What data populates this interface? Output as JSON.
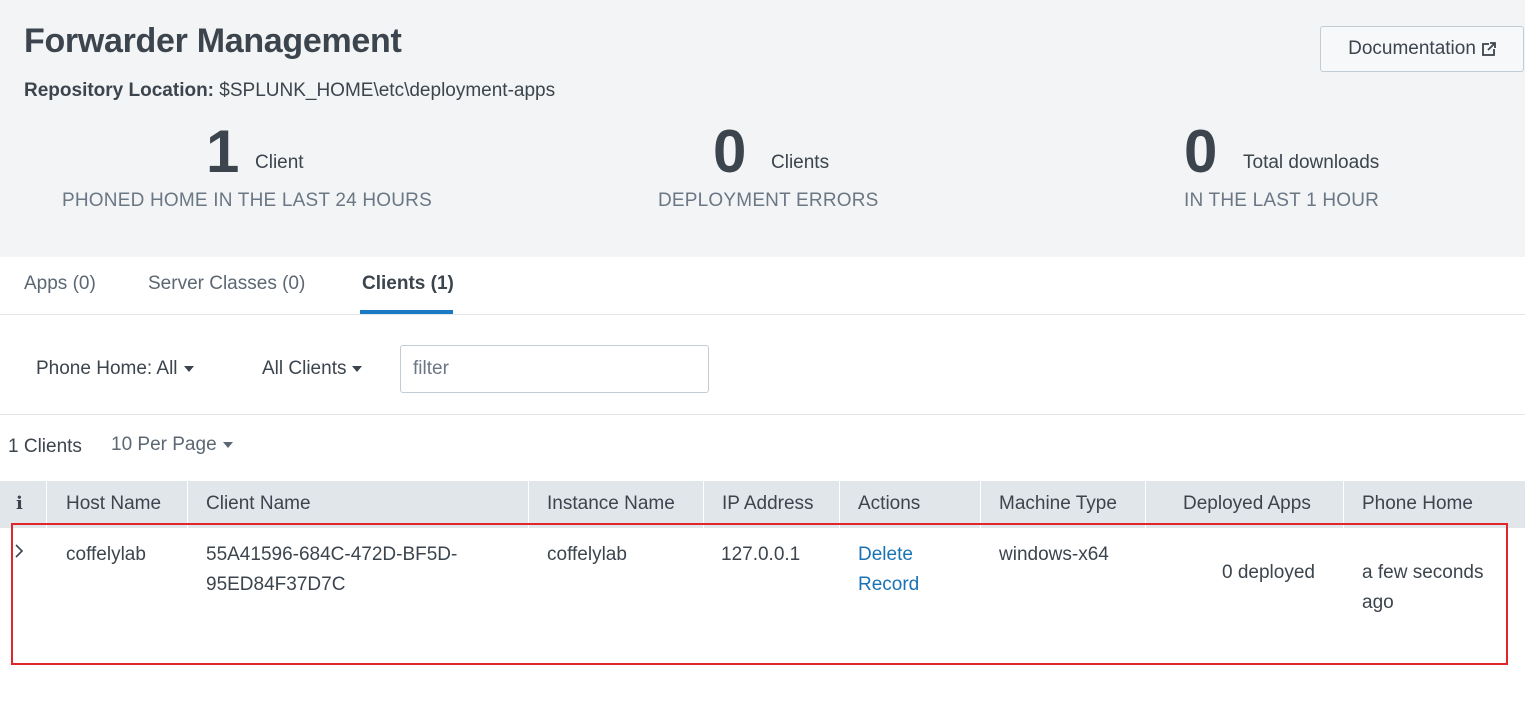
{
  "header": {
    "title": "Forwarder Management",
    "repo_label": "Repository Location:",
    "repo_path": "$SPLUNK_HOME\\etc\\deployment-apps",
    "doc_button": "Documentation",
    "doc_icon": "external-link-icon"
  },
  "stats": [
    {
      "value": "1",
      "unit": "Client",
      "caption": "PHONED HOME IN THE LAST 24 HOURS"
    },
    {
      "value": "0",
      "unit": "Clients",
      "caption": "DEPLOYMENT ERRORS"
    },
    {
      "value": "0",
      "unit": "Total downloads",
      "caption": "IN THE LAST 1 HOUR"
    }
  ],
  "tabs": [
    {
      "label": "Apps (0)",
      "active": false
    },
    {
      "label": "Server Classes (0)",
      "active": false
    },
    {
      "label": "Clients (1)",
      "active": true
    }
  ],
  "filters": {
    "phone_home": "Phone Home: All",
    "client_scope": "All Clients",
    "filter_placeholder": "filter"
  },
  "pagination": {
    "count": "1 Clients",
    "per_page": "10 Per Page"
  },
  "table": {
    "info_icon": "i",
    "columns": [
      "Host Name",
      "Client Name",
      "Instance Name",
      "IP Address",
      "Actions",
      "Machine Type",
      "Deployed Apps",
      "Phone Home"
    ],
    "rows": [
      {
        "host_name": "coffelylab",
        "client_name_line1": "55A41596-684C-472D-BF5D-",
        "client_name_line2": "95ED84F37D7C",
        "instance_name": "coffelylab",
        "ip_address": "127.0.0.1",
        "action_line1": "Delete",
        "action_line2": "Record",
        "machine_type": "windows-x64",
        "deployed_apps": "0 deployed",
        "phone_home_line1": "a few seconds",
        "phone_home_line2": "ago"
      }
    ]
  },
  "colors": {
    "header_bg": "#f2f4f5",
    "accent": "#1a7bc4",
    "link": "#1a73b5",
    "highlight_border": "#e0262b"
  }
}
